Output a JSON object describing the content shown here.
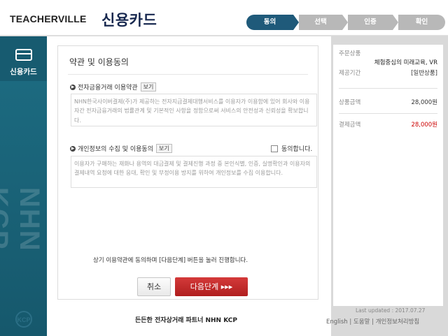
{
  "header": {
    "brand": "TEACHERVILLE",
    "title": "신용카드",
    "steps": [
      "동의",
      "선택",
      "인증",
      "확인"
    ]
  },
  "sidebar": {
    "tab_label": "신용카드",
    "watermark": "NHN KCP",
    "logo_text": "KCP"
  },
  "main": {
    "panel_title": "약관 및 이용동의",
    "section1": {
      "title": "전자금융거래 이용약관",
      "view": "보기",
      "text": "NHN한국사이버결제(주)가 제공하는 전자지급결제대행서비스를 이용자가 이용함에 있어 회사와 이용자간 전자금융거래의 법률관계 및 기본적인 사항을 정함으로써 서비스의 안전성과 신뢰성을 확보합니다."
    },
    "section2": {
      "title": "개인정보의 수집 및 이용동의",
      "view": "보기",
      "agree": "동의합니다.",
      "text": "이용자가 구매하는 재화나 용역의 대금결제 및 결제진행 과정 중 본인식별, 인증, 실명확인과 이용자의 결제내역 요청에 대한 응대, 확인 및 부정이용 방지를 위하여 개인정보를 수집 이용합니다."
    },
    "notice": "상기 이용약관에 동의하며 [다음단계] 버튼을 눌러 진행합니다.",
    "cancel": "취소",
    "next": "다음단계 ▸▸▸",
    "slogan": "든든한 전자상거래 파트너 NHN KCP"
  },
  "summary": {
    "product_label": "주문상품",
    "product_value": "체험중심의 미래교육, VR",
    "period_label": "제공기간",
    "period_value": "[일반상품]",
    "price_label": "상품금액",
    "price_value": "28,000원",
    "pay_label": "결제금액",
    "pay_value": "28,000원"
  },
  "footer": {
    "last_updated": "Last updated : 2017.07.27",
    "links": "English | 도움말 | 개인정보처리방침"
  },
  "colors": {
    "accent": "#1f5a7a",
    "sidebar": "#1d6d83",
    "next_button": "#c22a2a",
    "price_red": "#cc0000"
  }
}
